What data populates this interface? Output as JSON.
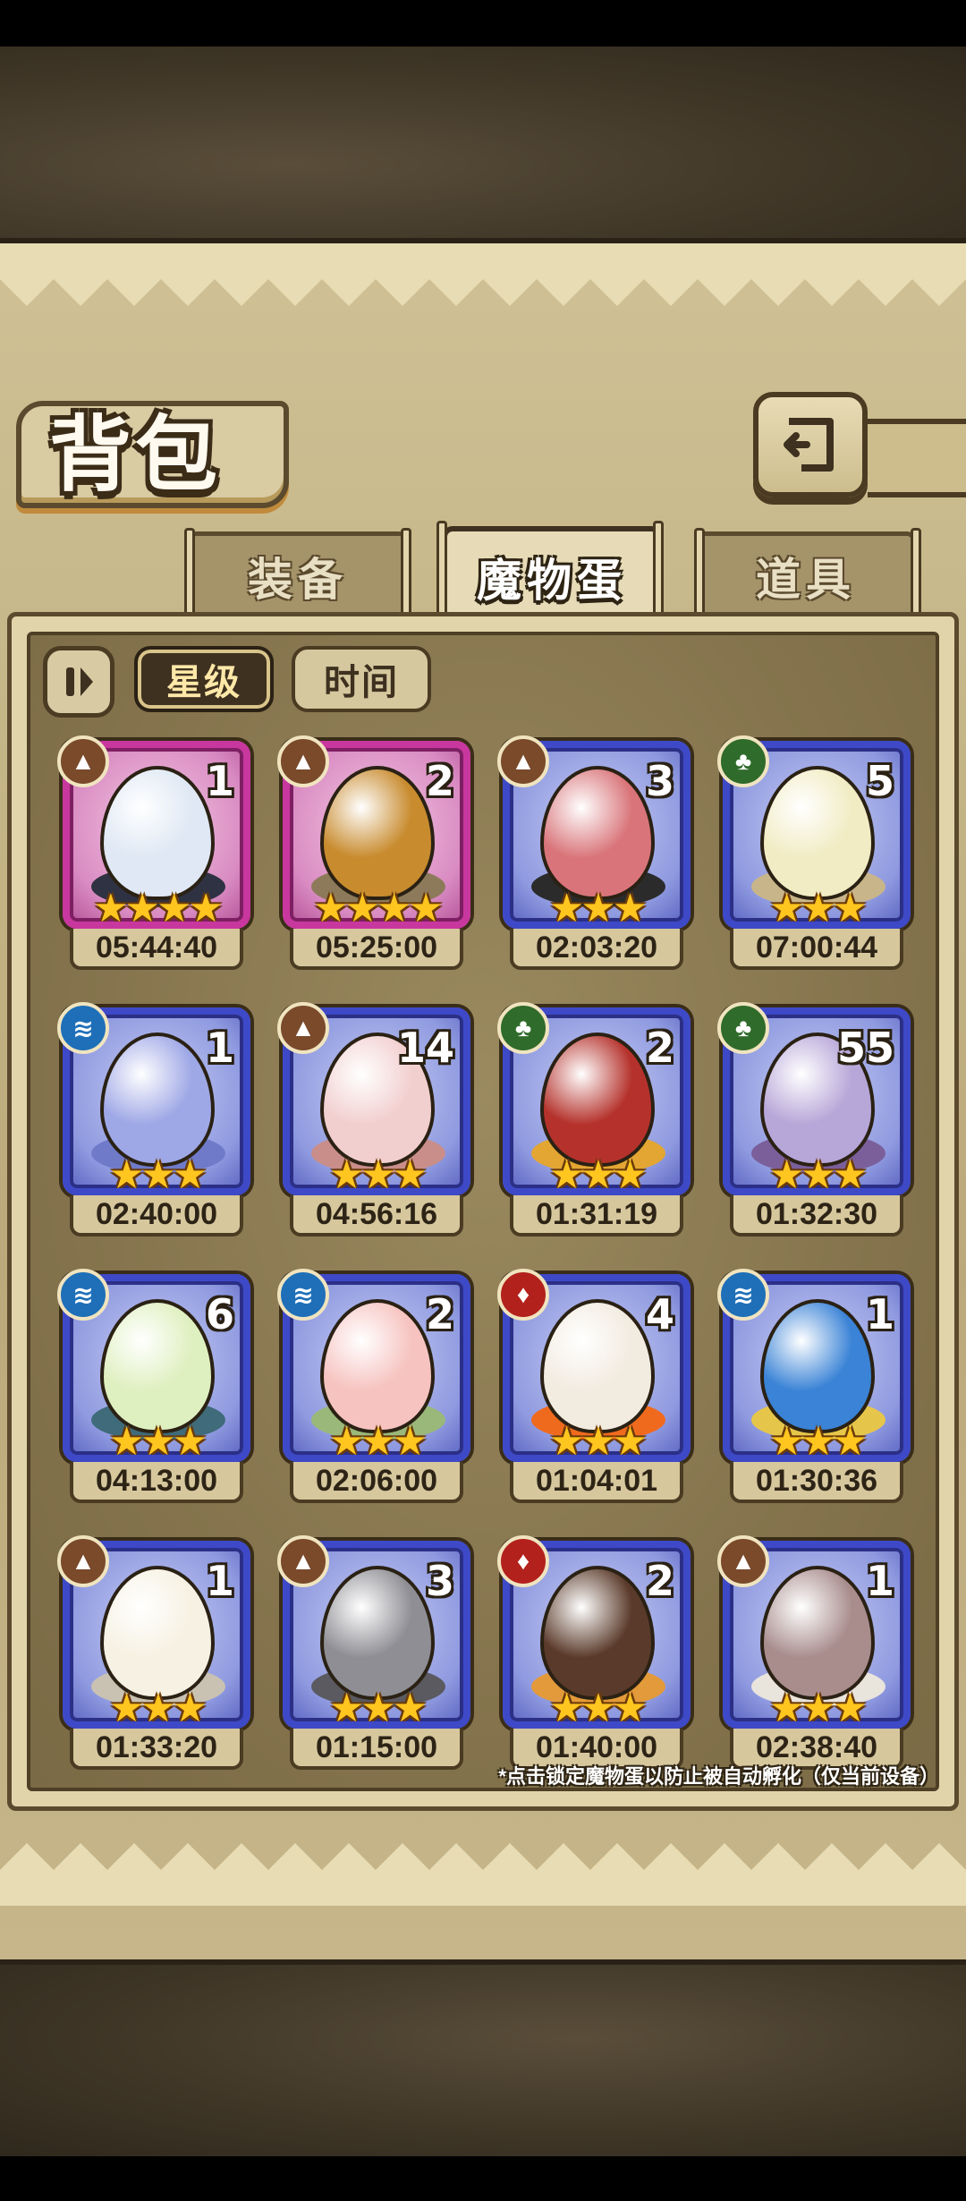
{
  "header": {
    "title": "背包",
    "back_icon": "back-arrow-icon"
  },
  "tabs": [
    {
      "label": "装备",
      "active": false
    },
    {
      "label": "魔物蛋",
      "active": true
    },
    {
      "label": "道具",
      "active": false
    }
  ],
  "sort": {
    "lock_icon": "pause-lock-icon",
    "by_star_label": "星级",
    "by_time_label": "时间",
    "selected": "星级"
  },
  "eggs": [
    {
      "count": "1",
      "time": "05:44:40",
      "stars": "★★★★",
      "element": "earth",
      "rarity": "pink",
      "egg_color": "#dfe8f4",
      "nest_color": "#2f3242"
    },
    {
      "count": "2",
      "time": "05:25:00",
      "stars": "★★★★",
      "element": "earth",
      "rarity": "pink",
      "egg_color": "#c88b2e",
      "nest_color": "#8d7a5a"
    },
    {
      "count": "3",
      "time": "02:03:20",
      "stars": "★★★",
      "element": "earth",
      "rarity": "blue",
      "egg_color": "#d9757a",
      "nest_color": "#2b2b2b"
    },
    {
      "count": "5",
      "time": "07:00:44",
      "stars": "★★★",
      "element": "wood",
      "rarity": "blue",
      "egg_color": "#f1ecc4",
      "nest_color": "#c9b58a"
    },
    {
      "count": "1",
      "time": "02:40:00",
      "stars": "★★★",
      "element": "water",
      "rarity": "blue",
      "egg_color": "#9fa8e6",
      "nest_color": "#6f7bc9"
    },
    {
      "count": "14",
      "time": "04:56:16",
      "stars": "★★★",
      "element": "earth",
      "rarity": "blue",
      "egg_color": "#f2cfcf",
      "nest_color": "#c98e8a"
    },
    {
      "count": "2",
      "time": "01:31:19",
      "stars": "★★★",
      "element": "wood",
      "rarity": "blue",
      "egg_color": "#b5322c",
      "nest_color": "#e3a632"
    },
    {
      "count": "55",
      "time": "01:32:30",
      "stars": "★★★",
      "element": "wood",
      "rarity": "blue",
      "egg_color": "#b7a6d8",
      "nest_color": "#7b5f9b"
    },
    {
      "count": "6",
      "time": "04:13:00",
      "stars": "★★★",
      "element": "water",
      "rarity": "blue",
      "egg_color": "#dff0c0",
      "nest_color": "#3f6b7a"
    },
    {
      "count": "2",
      "time": "02:06:00",
      "stars": "★★★",
      "element": "water",
      "rarity": "blue",
      "egg_color": "#f6c3c0",
      "nest_color": "#9ab87a"
    },
    {
      "count": "4",
      "time": "01:04:01",
      "stars": "★★★",
      "element": "fire",
      "rarity": "blue",
      "egg_color": "#f2ebe0",
      "nest_color": "#f06a1e"
    },
    {
      "count": "1",
      "time": "01:30:36",
      "stars": "★★★",
      "element": "water",
      "rarity": "blue",
      "egg_color": "#3a83d6",
      "nest_color": "#e6c64a"
    },
    {
      "count": "1",
      "time": "01:33:20",
      "stars": "★★★",
      "element": "earth",
      "rarity": "blue",
      "egg_color": "#f6f1e2",
      "nest_color": "#c9c2b2"
    },
    {
      "count": "3",
      "time": "01:15:00",
      "stars": "★★★",
      "element": "earth",
      "rarity": "blue",
      "egg_color": "#8e8e94",
      "nest_color": "#5a5a60"
    },
    {
      "count": "2",
      "time": "01:40:00",
      "stars": "★★★",
      "element": "fire",
      "rarity": "blue",
      "egg_color": "#5a3a2a",
      "nest_color": "#e39a3a"
    },
    {
      "count": "1",
      "time": "02:38:40",
      "stars": "★★★",
      "element": "earth",
      "rarity": "blue",
      "egg_color": "#a98d8d",
      "nest_color": "#e9e4dc"
    }
  ],
  "footnote": "*点击锁定魔物蛋以防止被自动孵化（仅当前设备）"
}
